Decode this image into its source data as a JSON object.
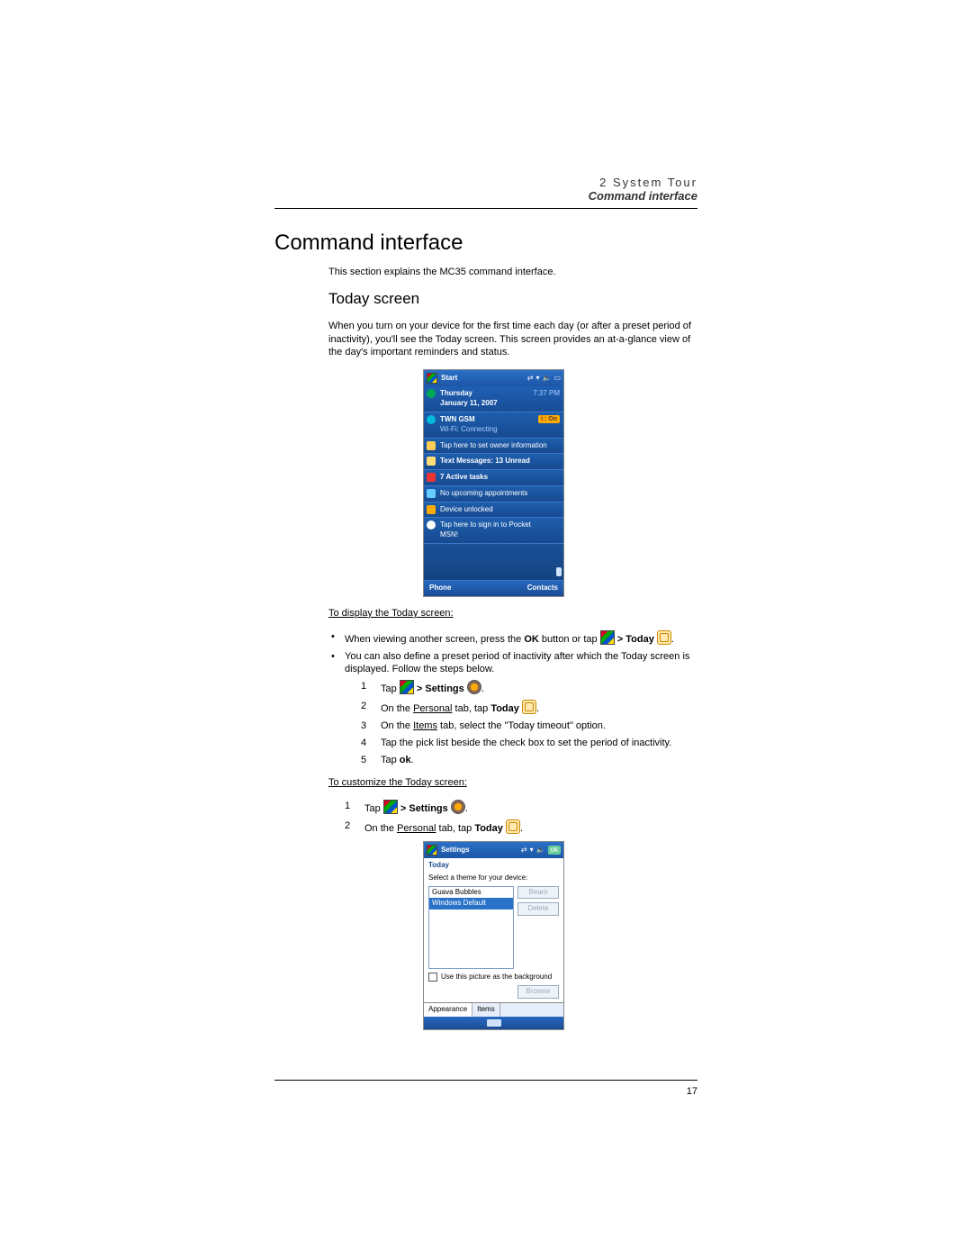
{
  "header": {
    "chapter": "2 System Tour",
    "section": "Command interface"
  },
  "h1": "Command interface",
  "intro": "This section explains the MC35 command interface.",
  "h2": "Today screen",
  "lead": "When you turn on your device for the first time each day (or after a preset period of inactivity), you'll see the Today screen. This screen provides an at-a-glance view of the day's important reminders and status.",
  "today_device": {
    "title": "Start",
    "date_line1": "Thursday",
    "date_line2": "January 11, 2007",
    "time": "7:37 PM",
    "carrier": "TWN GSM",
    "wifi": "Wi-Fi: Connecting",
    "wifi_badge": "i : On",
    "rows": {
      "owner": "Tap here to set owner information",
      "msgs": "Text Messages: 13 Unread",
      "tasks": "7 Active tasks",
      "appts": "No upcoming appointments",
      "lock": "Device unlocked",
      "msn": "Tap here to sign in to Pocket MSN!"
    },
    "soft_left": "Phone",
    "soft_right": "Contacts"
  },
  "sub1": "To display the Today screen:",
  "b1a_pre": "When viewing another screen, press the ",
  "b1a_ok": "OK",
  "b1a_mid": " button or tap ",
  "b1a_today": " Today",
  "b1b": "You can also define a preset period of inactivity after which the Today screen is displayed. Follow the steps below.",
  "steps1": {
    "s1_pre": "Tap ",
    "s1_set": " Settings",
    "s2_pre": "On the ",
    "s2_tab": "Personal",
    "s2_mid": " tab, tap ",
    "s2_today": "Today",
    "s3": "On the ",
    "s3_tab": "Items",
    "s3_post": " tab, select the \"Today timeout\" option.",
    "s4": "Tap the pick list beside the check box to set the period of inactivity.",
    "s5_pre": "Tap ",
    "s5_ok": "ok"
  },
  "sub2": "To customize the Today screen:",
  "steps2": {
    "s1_pre": "Tap ",
    "s1_set": " Settings",
    "s2_pre": "On the ",
    "s2_tab": "Personal",
    "s2_mid": " tab, tap ",
    "s2_today": "Today"
  },
  "settings_device": {
    "title": "Settings",
    "ok": "ok",
    "page_title": "Today",
    "label": "Select a theme for your device:",
    "theme1": "Guava Bubbles",
    "theme2": "Windows Default",
    "beam": "Beam",
    "delete": "Delete",
    "chk_label": "Use this picture as the background",
    "browse": "Browse",
    "tab1": "Appearance",
    "tab2": "Items"
  },
  "page_number": "17"
}
